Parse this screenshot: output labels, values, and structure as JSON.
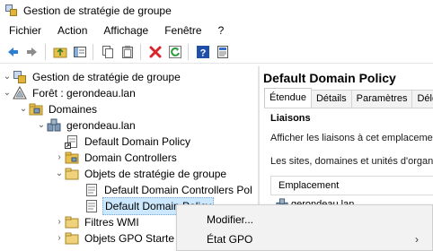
{
  "window": {
    "title": "Gestion de stratégie de groupe",
    "icon": "gpmc-app-icon"
  },
  "menu": [
    "Fichier",
    "Action",
    "Affichage",
    "Fenêtre",
    "?"
  ],
  "toolbar": {
    "buttons": [
      "back-arrow-icon",
      "forward-arrow-icon",
      "up-folder-icon",
      "show-hide-tree-icon",
      "copy-icon",
      "paste-icon",
      "delete-icon",
      "refresh-icon",
      "help-icon",
      "properties-icon"
    ]
  },
  "tree": {
    "items": [
      {
        "label": "Gestion de stratégie de groupe",
        "icon": "gpmc-icon",
        "expanded": true
      },
      {
        "label": "Forêt : gerondeau.lan",
        "icon": "forest-icon",
        "expanded": true
      },
      {
        "label": "Domaines",
        "icon": "domains-folder-icon",
        "expanded": true
      },
      {
        "label": "gerondeau.lan",
        "icon": "domain-icon",
        "expanded": true
      },
      {
        "label": "Default Domain Policy",
        "icon": "gpo-link-icon"
      },
      {
        "label": "Domain Controllers",
        "icon": "ou-folder-icon",
        "expandable": true
      },
      {
        "label": "Objets de stratégie de groupe",
        "icon": "folder-icon",
        "expanded": true
      },
      {
        "label": "Default Domain Controllers Pol",
        "icon": "gpo-icon"
      },
      {
        "label": "Default Domain Policy",
        "icon": "gpo-icon",
        "selected": true
      },
      {
        "label": "Filtres WMI",
        "icon": "folder-icon",
        "expandable": true
      },
      {
        "label": "Objets GPO Starte",
        "icon": "folder-icon",
        "expandable": true
      }
    ]
  },
  "details": {
    "title": "Default Domain Policy",
    "tabs": [
      "Étendue",
      "Détails",
      "Paramètres",
      "Délé"
    ],
    "active_tab": "Étendue",
    "section_title": "Liaisons",
    "text_1": "Afficher les liaisons à cet emplacement",
    "text_2": "Les sites, domaines et unités d'organis",
    "table": {
      "header": "Emplacement",
      "rows": [
        "gerondeau.lan"
      ]
    }
  },
  "context_menu": {
    "items": [
      {
        "label": "Modifier..."
      },
      {
        "label": "État GPO",
        "submenu": true
      }
    ]
  },
  "colors": {
    "selection": "#cce8ff",
    "delete_red": "#d9242b",
    "refresh_green": "#2a9a3a",
    "help_blue": "#1f4fa8"
  }
}
